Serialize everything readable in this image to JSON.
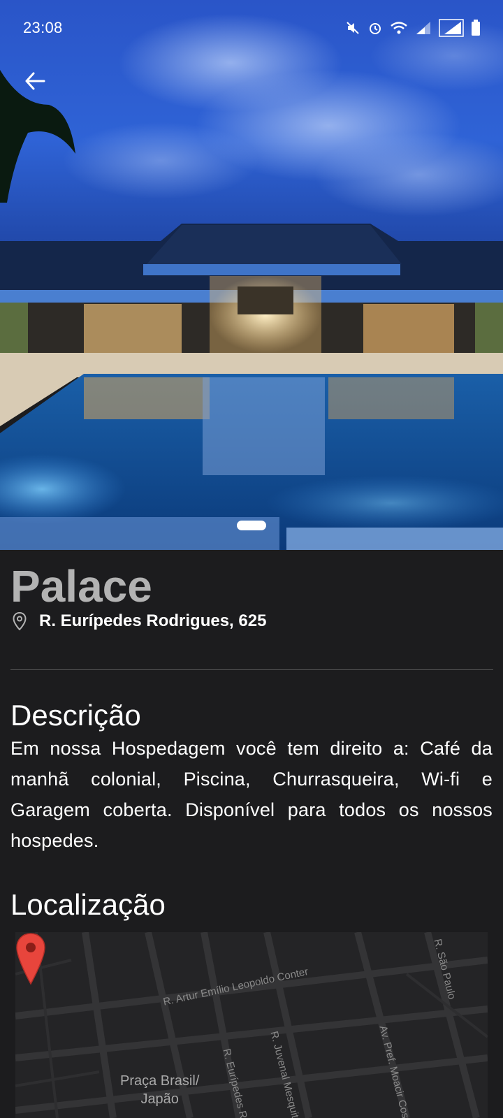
{
  "status_bar": {
    "time": "23:08",
    "icons": [
      "mute-icon",
      "alarm-icon",
      "wifi-icon",
      "signal-icon",
      "signal-icon",
      "battery-icon"
    ]
  },
  "hero": {
    "image": "hotel-pool-at-dusk",
    "page_count": 1,
    "active_page": 1
  },
  "hotel": {
    "name": "Palace",
    "address": "R. Eurípedes Rodrigues, 625"
  },
  "description_section": {
    "title": "Descrição",
    "text": "Em nossa Hospedagem você tem direito a: Café da manhã colonial, Piscina, Churrasqueira, Wi-fi e Garagem coberta. Disponível para todos os nossos hospedes."
  },
  "location_section": {
    "title": "Localização",
    "map": {
      "streets": [
        "R. Artur Emílio Leopoldo Conter",
        "R. São Paulo",
        "R. Juvenal Mesquita",
        "Av. Pref. Moacir Costa",
        "R. Eurípedes Rodrigues"
      ],
      "place_label_line1": "Praça Brasil/",
      "place_label_line2": "Japão",
      "pin": "red-location-pin"
    }
  },
  "colors": {
    "background": "#1c1c1e",
    "title": "#b3b3b3",
    "text": "#ffffff",
    "divider": "#555555",
    "map_bg": "#242426",
    "pin": "#e8453c"
  }
}
